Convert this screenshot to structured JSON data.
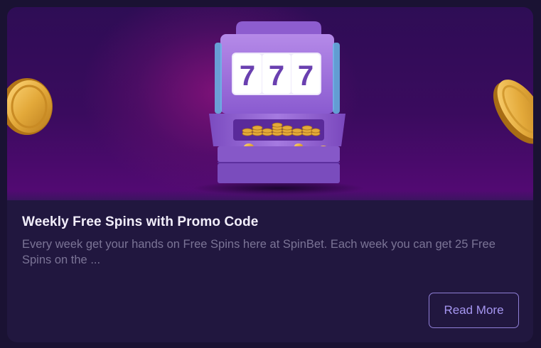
{
  "promo": {
    "title": "Weekly Free Spins with Promo Code",
    "description": "Every week get your hands on Free Spins here at SpinBet. Each week you can get 25 Free Spins on the ...",
    "button_label": "Read More",
    "slot_reels": [
      "7",
      "7",
      "7"
    ]
  },
  "colors": {
    "card_background": "#21173f",
    "page_background": "#1a1233",
    "title_text": "#f2eefb",
    "description_text": "#7b7496",
    "button_border": "#8f7fd6",
    "button_text": "#a596f0",
    "banner_purple": "#3a0b5e",
    "slot_machine": "#9b6ad4",
    "coin_gold": "#e3aa3a"
  },
  "icons": [
    "slot-machine-illustration",
    "gold-coin-icon"
  ]
}
